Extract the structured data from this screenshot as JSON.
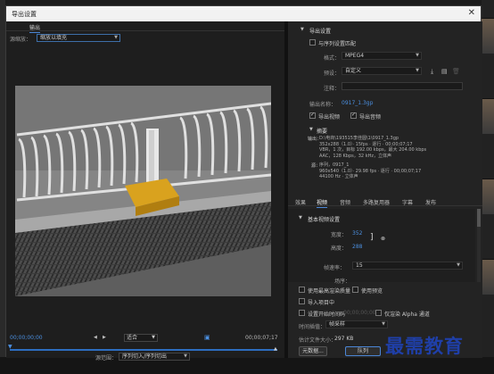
{
  "dialog": {
    "title": "导出设置",
    "close_icon": "close-icon"
  },
  "left": {
    "tab_output": "输出",
    "scale_label": "源缩放：",
    "scale_value": "缩放以填充",
    "timecode_start": "00;00;00;00",
    "fit_value": "适合",
    "timecode_end": "00;00;07;17",
    "range_label": "源范围：",
    "range_value": "序列切入/序列切出"
  },
  "export": {
    "heading": "导出设置",
    "match_sequence": "与序列设置匹配",
    "format_label": "格式：",
    "format_value": "MPEG4",
    "preset_label": "预设：",
    "preset_value": "自定义",
    "comment_label": "注释：",
    "output_name_label": "输出名称：",
    "output_name_value": "0917_1.3gp",
    "export_video": "导出视频",
    "export_audio": "导出音频",
    "summary_heading": "摘要",
    "output_label": "输出：",
    "output_lines": [
      "D:\\电商\\193515李佳圆\\1\\0917_1.3gp",
      "352x288（1.0）· 15fps · 逐行 · 00;00;07;17",
      "VBR，1 次，目标 192.00 kbps，最大 204.00 kbps",
      "AAC，128 Kbps，32 kHz，立体声"
    ],
    "source_label": "源：",
    "source_lines": [
      "序列，0917_1",
      "960x540（1.0）· 29.98 fps · 逐行 · 00;00;07;17",
      "44100 Hz · 立体声"
    ]
  },
  "tabs": [
    "效果",
    "视频",
    "音频",
    "多路复用器",
    "字幕",
    "发布"
  ],
  "active_tab": "视频",
  "video": {
    "heading": "基本视频设置",
    "width_label": "宽度：",
    "width_value": "352",
    "height_label": "高度：",
    "height_value": "288",
    "framerate_label": "帧速率：",
    "framerate_value": "15",
    "field_label": "场序："
  },
  "bottom": {
    "max_render": "使用最高渲染质量",
    "use_previews": "使用预览",
    "import_project": "导入项目中",
    "set_start_timecode": "设置开始时间码",
    "render_alpha": "仅渲染 Alpha 通道",
    "interp_label": "时间插值：",
    "interp_value": "帧采样",
    "filesize_label": "估计文件大小：",
    "filesize_value": "297 KB",
    "metadata_button": "元数据...",
    "queue_button": "队列"
  },
  "watermark": "最需教育"
}
